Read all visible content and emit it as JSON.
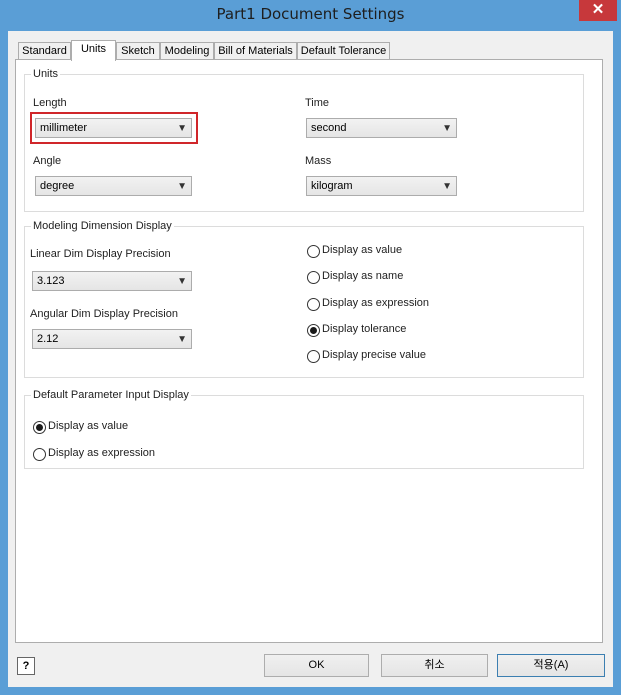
{
  "window": {
    "title": "Part1 Document Settings",
    "close_glyph": "✕"
  },
  "tabs": [
    {
      "label": "Standard"
    },
    {
      "label": "Units"
    },
    {
      "label": "Sketch"
    },
    {
      "label": "Modeling"
    },
    {
      "label": "Bill of Materials"
    },
    {
      "label": "Default Tolerance"
    }
  ],
  "active_tab": "Units",
  "units": {
    "legend": "Units",
    "length_label": "Length",
    "length_value": "millimeter",
    "time_label": "Time",
    "time_value": "second",
    "angle_label": "Angle",
    "angle_value": "degree",
    "mass_label": "Mass",
    "mass_value": "kilogram"
  },
  "modeling_dim": {
    "legend": "Modeling Dimension Display",
    "linear_label": "Linear Dim Display Precision",
    "linear_value": "3.123",
    "angular_label": "Angular Dim Display Precision",
    "angular_value": "2.12",
    "options": [
      {
        "label": "Display as value",
        "checked": false
      },
      {
        "label": "Display as name",
        "checked": false
      },
      {
        "label": "Display as expression",
        "checked": false
      },
      {
        "label": "Display tolerance",
        "checked": true
      },
      {
        "label": "Display precise value",
        "checked": false
      }
    ]
  },
  "param_input": {
    "legend": "Default Parameter Input Display",
    "options": [
      {
        "label": "Display as value",
        "checked": true
      },
      {
        "label": "Display as expression",
        "checked": false
      }
    ]
  },
  "footer": {
    "help_glyph": "?",
    "ok_label": "OK",
    "cancel_label": "취소",
    "apply_label": "적용(A)"
  },
  "icons": {
    "dropdown_arrow": "chevron-down-icon"
  },
  "colors": {
    "title_bar": "#5a9ed6",
    "highlight": "#d0262a",
    "close": "#c7383b"
  }
}
